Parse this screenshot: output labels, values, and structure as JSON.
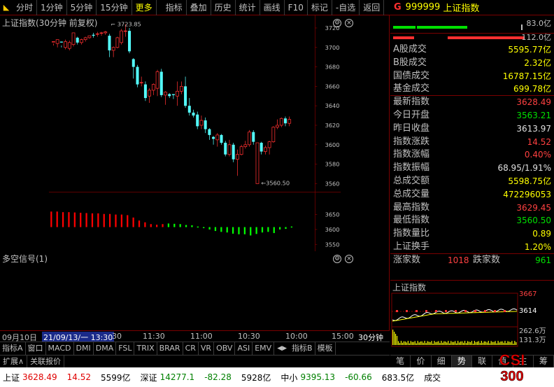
{
  "toolbar": {
    "items": [
      "分时",
      "1分钟",
      "5分钟",
      "15分钟",
      "更多",
      "指标",
      "叠加",
      "历史",
      "统计",
      "画线",
      "F10",
      "标记",
      "-自选",
      "返回"
    ]
  },
  "chart": {
    "title": "上证指数(30分钟 前复权)",
    "indicator_title": "多空信号(1)",
    "high_label": "3723.85",
    "low_label": "3560.50",
    "main_axis": [
      "3720",
      "3700",
      "3680",
      "3660",
      "3640",
      "3620",
      "3600",
      "3580",
      "3560"
    ],
    "ind_axis": [
      "3650",
      "3600",
      "3550"
    ]
  },
  "chart_data": {
    "type": "candlestick",
    "title": "上证指数(30分钟 前复权)",
    "period": "30分钟",
    "ylim": [
      3550,
      3730
    ],
    "annotations": {
      "high": 3723.85,
      "low": 3560.5
    },
    "candles": [
      [
        3706,
        3706,
        3704,
        3702
      ],
      [
        3704,
        3708,
        3708,
        3700
      ],
      [
        3706,
        3705,
        3702,
        3700
      ],
      [
        3700,
        3706,
        3708,
        3698
      ],
      [
        3699,
        3705,
        3707,
        3697
      ],
      [
        3703,
        3715,
        3715,
        3701
      ],
      [
        3710,
        3705,
        3711,
        3703
      ],
      [
        3705,
        3708,
        3709,
        3703
      ],
      [
        3708,
        3710,
        3711,
        3706
      ],
      [
        3710,
        3712,
        3712,
        3709
      ],
      [
        3713,
        3712,
        3715,
        3710
      ],
      [
        3714,
        3714,
        3716,
        3711
      ],
      [
        3715,
        3715,
        3716,
        3712
      ],
      [
        3715,
        3716,
        3717,
        3713
      ],
      [
        3712,
        3697,
        3714,
        3690
      ],
      [
        3697,
        3700,
        3701,
        3690
      ],
      [
        3700,
        3710,
        3711,
        3699
      ],
      [
        3705,
        3717,
        3719,
        3703
      ],
      [
        3717,
        3717,
        3724,
        3711
      ],
      [
        3717,
        3696,
        3720,
        3694
      ],
      [
        3688,
        3680,
        3689,
        3668
      ],
      [
        3680,
        3662,
        3682,
        3659
      ],
      [
        3664,
        3664,
        3670,
        3660
      ],
      [
        3662,
        3648,
        3665,
        3645
      ],
      [
        3650,
        3656,
        3658,
        3643
      ],
      [
        3656,
        3662,
        3663,
        3651
      ],
      [
        3658,
        3675,
        3677,
        3650
      ],
      [
        3675,
        3651,
        3678,
        3649
      ],
      [
        3651,
        3654,
        3655,
        3641
      ],
      [
        3652,
        3650,
        3653,
        3648
      ],
      [
        3652,
        3651,
        3652,
        3647
      ],
      [
        3650,
        3655,
        3665,
        3640
      ],
      [
        3655,
        3660,
        3665,
        3652
      ],
      [
        3660,
        3640,
        3670,
        3638
      ],
      [
        3640,
        3633,
        3648,
        3630
      ],
      [
        3633,
        3630,
        3636,
        3628
      ],
      [
        3631,
        3619,
        3634,
        3616
      ],
      [
        3620,
        3625,
        3630,
        3616
      ],
      [
        3625,
        3616,
        3628,
        3612
      ],
      [
        3616,
        3610,
        3617,
        3605
      ],
      [
        3608,
        3606,
        3609,
        3600
      ],
      [
        3605,
        3610,
        3612,
        3598
      ],
      [
        3610,
        3602,
        3611,
        3600
      ],
      [
        3602,
        3590,
        3604,
        3588
      ],
      [
        3590,
        3600,
        3605,
        3588
      ],
      [
        3600,
        3585,
        3602,
        3582
      ],
      [
        3585,
        3590,
        3595,
        3568
      ],
      [
        3590,
        3598,
        3600,
        3589
      ],
      [
        3598,
        3600,
        3604,
        3596
      ],
      [
        3600,
        3613,
        3615,
        3598
      ],
      [
        3613,
        3603,
        3615,
        3600
      ],
      [
        3560,
        3602,
        3602,
        3561
      ],
      [
        3602,
        3593,
        3603,
        3590
      ],
      [
        3593,
        3597,
        3599,
        3590
      ],
      [
        3597,
        3603,
        3604,
        3590
      ],
      [
        3603,
        3618,
        3619,
        3602
      ],
      [
        3618,
        3620,
        3626,
        3616
      ],
      [
        3620,
        3627,
        3628,
        3618
      ],
      [
        3627,
        3622,
        3629,
        3619
      ],
      [
        3622,
        3626,
        3629,
        3619
      ]
    ],
    "ind_values": [
      3660,
      3660,
      3658,
      3658,
      3657,
      3656,
      3655,
      3654,
      3654,
      3652,
      3652,
      3650,
      3650,
      3648,
      3640,
      3630,
      3624,
      3618,
      3616,
      3618,
      3620,
      3619,
      3618,
      3615,
      3614,
      3610,
      3605,
      3600,
      3595,
      3592,
      3590,
      3586,
      3584,
      3584,
      3580,
      3585,
      3590,
      3592,
      3588,
      3600,
      3602,
      3610
    ],
    "ind_first_green_index": 20
  },
  "date_bar": {
    "d1": "09月10日",
    "d2": "21/09/13/一 13:30",
    "d3": "30",
    "d4": "11:30",
    "d5": "11:00",
    "d6": "10:30",
    "d7": "10:00",
    "d8": "15:00",
    "period": "30分钟"
  },
  "indicator_tabs": [
    "指标A",
    "窗口",
    "MACD",
    "DMI",
    "DMA",
    "FSL",
    "TRIX",
    "BRAR",
    "CR",
    "VR",
    "OBV",
    "ASI",
    "EMV",
    "指标B",
    "模板"
  ],
  "ext_tabs": [
    "扩展∧",
    "关联报价"
  ],
  "quote": {
    "flag": "G",
    "code": "999999",
    "name": "上证指数",
    "bar1_value": "83.0亿",
    "bar2_value": "112.0亿",
    "rows_a": [
      {
        "label": "A股成交",
        "value": "5595.77亿"
      },
      {
        "label": "B股成交",
        "value": "2.32亿"
      },
      {
        "label": "国债成交",
        "value": "16787.15亿"
      },
      {
        "label": "基金成交",
        "value": "699.78亿"
      }
    ],
    "rows_b": [
      {
        "label": "最新指数",
        "value": "3628.49",
        "color": "red"
      },
      {
        "label": "今日开盘",
        "value": "3563.21",
        "color": "green"
      },
      {
        "label": "昨日收盘",
        "value": "3613.97",
        "color": "white"
      },
      {
        "label": "指数涨跌",
        "value": "14.52",
        "color": "red"
      },
      {
        "label": "指数涨幅",
        "value": "0.40%",
        "color": "red"
      },
      {
        "label": "指数振幅",
        "value": "68.95/1.91%",
        "color": "white"
      },
      {
        "label": "总成交额",
        "value": "5598.75亿",
        "color": "yellow"
      },
      {
        "label": "总成交量",
        "value": "472296053",
        "color": "yellow"
      },
      {
        "label": "最高指数",
        "value": "3629.45",
        "color": "red"
      },
      {
        "label": "最低指数",
        "value": "3560.50",
        "color": "green"
      },
      {
        "label": "指数量比",
        "value": "0.89",
        "color": "yellow"
      },
      {
        "label": "上证换手",
        "value": "1.20%",
        "color": "yellow"
      }
    ],
    "up_label": "涨家数",
    "up_value": "1018",
    "down_label": "跌家数",
    "down_value": "961"
  },
  "mini": {
    "title": "上证指数",
    "y_high": "3667",
    "y_mid": "3614",
    "vol_high": "262.6万",
    "vol_mid": "131.3万"
  },
  "rp_tabs": [
    "笔",
    "价",
    "细",
    "势",
    "联",
    "值",
    "主",
    "筹"
  ],
  "status": [
    {
      "name": "上证",
      "price": "3628.49",
      "change": "14.52",
      "amount": "5599亿",
      "dir": "up"
    },
    {
      "name": "深证",
      "price": "14277.1",
      "change": "-82.28",
      "amount": "5928亿",
      "dir": "down"
    },
    {
      "name": "中小",
      "price": "9395.13",
      "change": "-60.66",
      "amount": "683.5亿",
      "dir": "down"
    },
    {
      "name": "成交",
      "price": "",
      "change": "",
      "amount": "",
      "dir": "none"
    }
  ],
  "colors": {
    "up": "#ff3030",
    "down": "#54ffff",
    "ind_red": "#ff0000",
    "ind_green": "#00ff00",
    "grid": "#7a0000"
  }
}
